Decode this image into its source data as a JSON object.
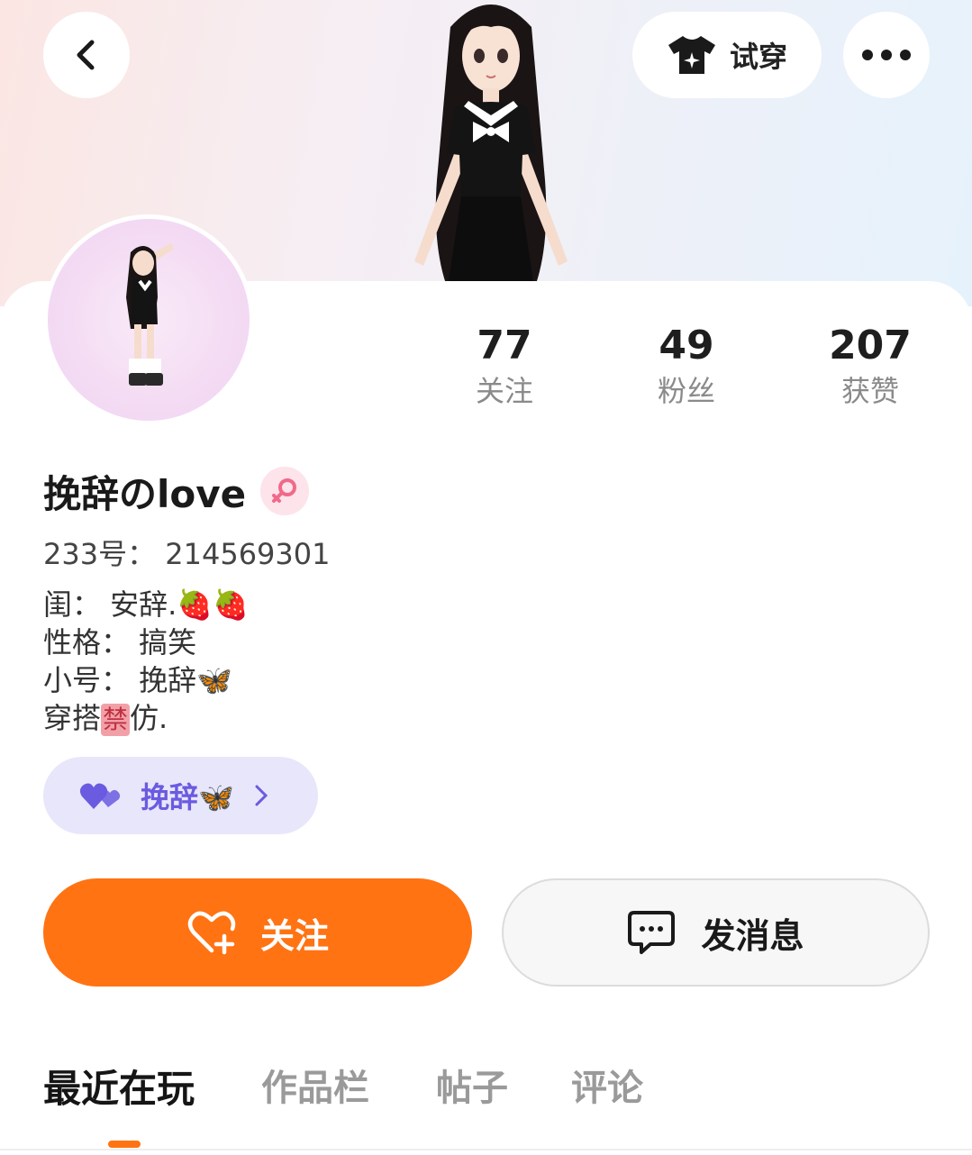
{
  "header": {
    "try_on_label": "试穿"
  },
  "stats": [
    {
      "value": "77",
      "label": "关注"
    },
    {
      "value": "49",
      "label": "粉丝"
    },
    {
      "value": "207",
      "label": "获赞"
    }
  ],
  "profile": {
    "name": "挽辞のlove",
    "gender_symbol": "♀",
    "uid": "233号： 214569301",
    "bio": [
      "闺： 安辞.🍓🍓",
      "性格： 搞笑",
      "小号： 挽辞🦋"
    ],
    "bio_last_prefix": "穿搭",
    "bio_last_badge": "禁",
    "bio_last_suffix": "仿."
  },
  "partner": {
    "name": "挽辞🦋"
  },
  "actions": {
    "follow_label": "关注",
    "message_label": "发消息"
  },
  "tabs": [
    {
      "label": "最近在玩",
      "active": true
    },
    {
      "label": "作品栏",
      "active": false
    },
    {
      "label": "帖子",
      "active": false
    },
    {
      "label": "评论",
      "active": false
    }
  ],
  "colors": {
    "accent": "#ff7313",
    "partner_bg": "#e8e6fb",
    "partner_text": "#6a5be0",
    "gender_bg": "#fde3ea",
    "gender_fg": "#f06a8a"
  }
}
